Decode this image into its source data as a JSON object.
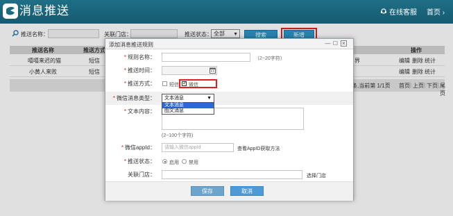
{
  "header": {
    "title": "消息推送",
    "service_label": "在线客服",
    "home_label": "首页",
    "home_chevron": "›"
  },
  "search": {
    "name_label": "推送名称：",
    "store_label": "关联门店：",
    "status_label": "推送状态：",
    "status_value": "全部",
    "search_button": "搜索",
    "add_button": "新增"
  },
  "table": {
    "columns": [
      "推送名称",
      "推送方式",
      "操作"
    ],
    "rows": [
      {
        "name": "嘻嘻来迟的猫",
        "method": "短信",
        "extra": "界",
        "actions": [
          "编辑",
          "删除",
          "统计"
        ]
      },
      {
        "name": "小黄人来败",
        "method": "短信",
        "extra": "",
        "actions": [
          "编辑",
          "删除",
          "统计"
        ]
      }
    ],
    "pager": {
      "summary": "条,当前第 1/1页",
      "first": "首页",
      "prev": "上页",
      "next": "下页",
      "last": "尾页"
    }
  },
  "dialog": {
    "title": "添加消息推送规则",
    "rule_name": {
      "label": "规则名称：",
      "hint": "（2~20字符）",
      "value": ""
    },
    "push_time": {
      "label": "推送时间：",
      "value": ""
    },
    "push_method": {
      "label": "推送方式：",
      "options": [
        {
          "label": "短信",
          "checked": false
        },
        {
          "label": "微信",
          "checked": true
        }
      ]
    },
    "wechat_type": {
      "label": "微信消息类型：",
      "value": "文本消息",
      "options": [
        "文本消息",
        "图文消息"
      ]
    },
    "text_content": {
      "label": "文本内容：",
      "hint": "(2~100个字符)"
    },
    "appid": {
      "label": "微信appId：",
      "placeholder": "请输入微信appId",
      "link": "查看AppID获取方法"
    },
    "push_status": {
      "label": "推送状态：",
      "options": [
        {
          "label": "启用",
          "selected": true
        },
        {
          "label": "禁用",
          "selected": false
        }
      ]
    },
    "store": {
      "label": "关联门店：",
      "hint": "选择门店"
    },
    "save_button": "保存",
    "cancel_button": "取消"
  },
  "colors": {
    "header_bg": "#1a6a80",
    "accent": "#2c94c8",
    "highlight": "#e02020"
  }
}
